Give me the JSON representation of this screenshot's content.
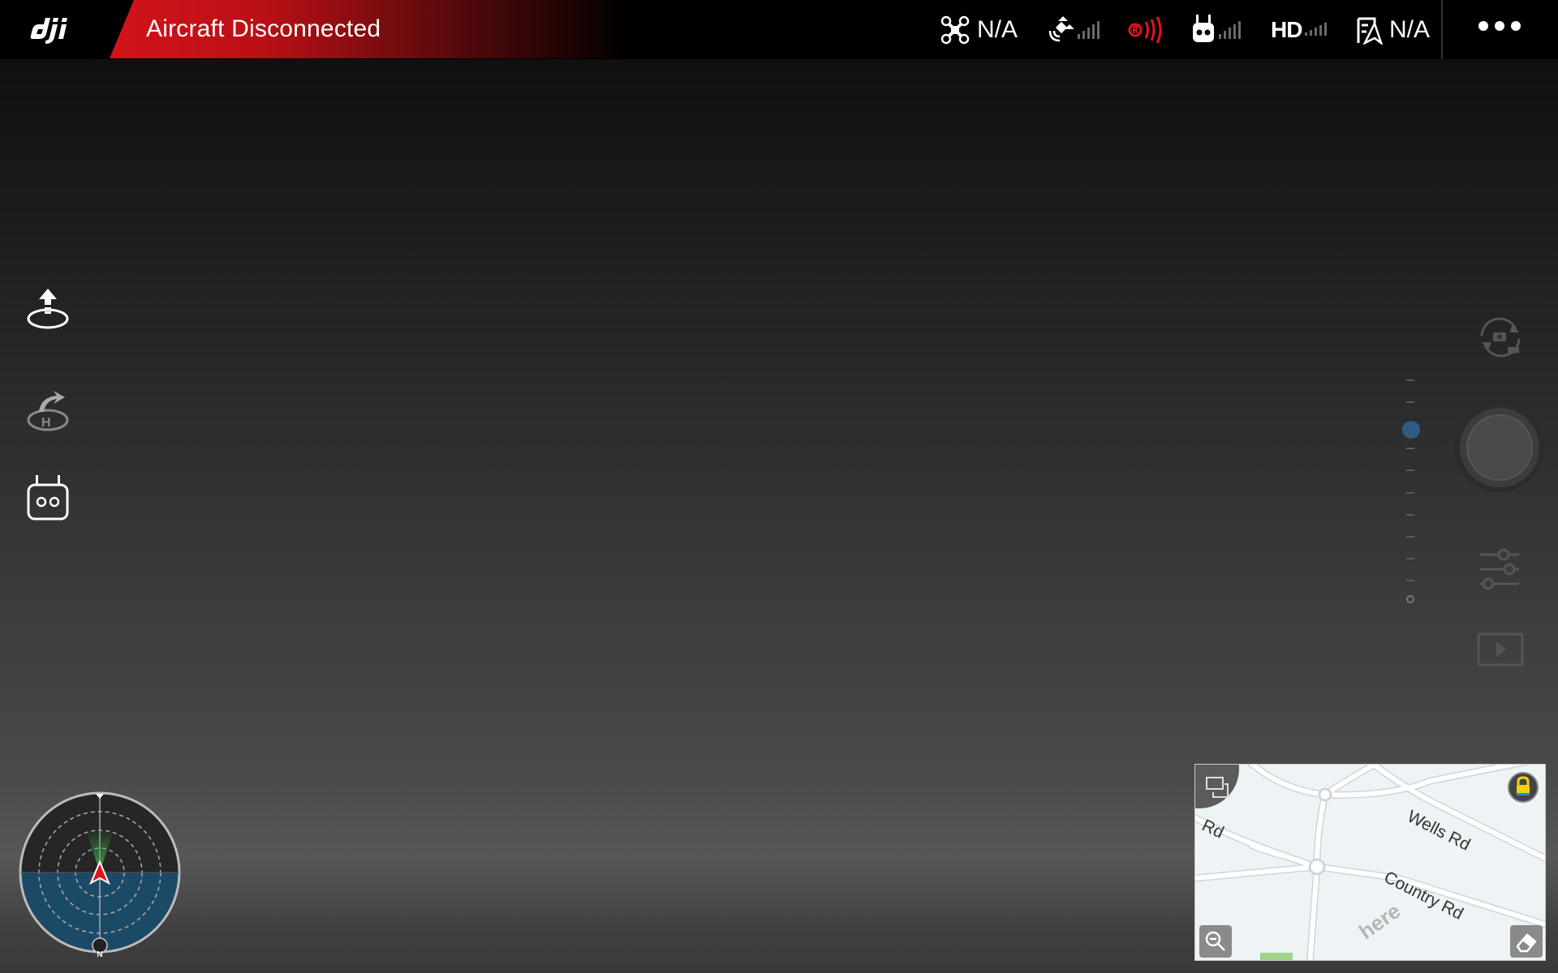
{
  "topbar": {
    "status": "Aircraft Disconnected",
    "aircraft_value": "N/A",
    "video_label": "HD",
    "flight_mode_value": "N/A",
    "status_color": "#d4121a"
  },
  "icons": {
    "logo": "dji-logo",
    "aircraft": "aircraft-icon",
    "gps": "satellite-icon",
    "obstacle": "obstacle-sensing-icon",
    "remote": "remote-controller-icon",
    "hd": "hd-signal-icon",
    "mode": "flight-mode-icon",
    "more": "more-icon",
    "takeoff": "takeoff-icon",
    "return_home": "return-home-icon",
    "rc": "remote-controller-icon",
    "camera_switch": "camera-switch-icon",
    "shutter": "shutter-button",
    "settings": "settings-sliders-icon",
    "playback": "playback-icon"
  },
  "map": {
    "labels": [
      "Rd",
      "Wells Rd",
      "Country Rd"
    ],
    "watermark": "here",
    "radar_north": "N"
  },
  "zoom": {
    "level_fraction": 0.2
  }
}
